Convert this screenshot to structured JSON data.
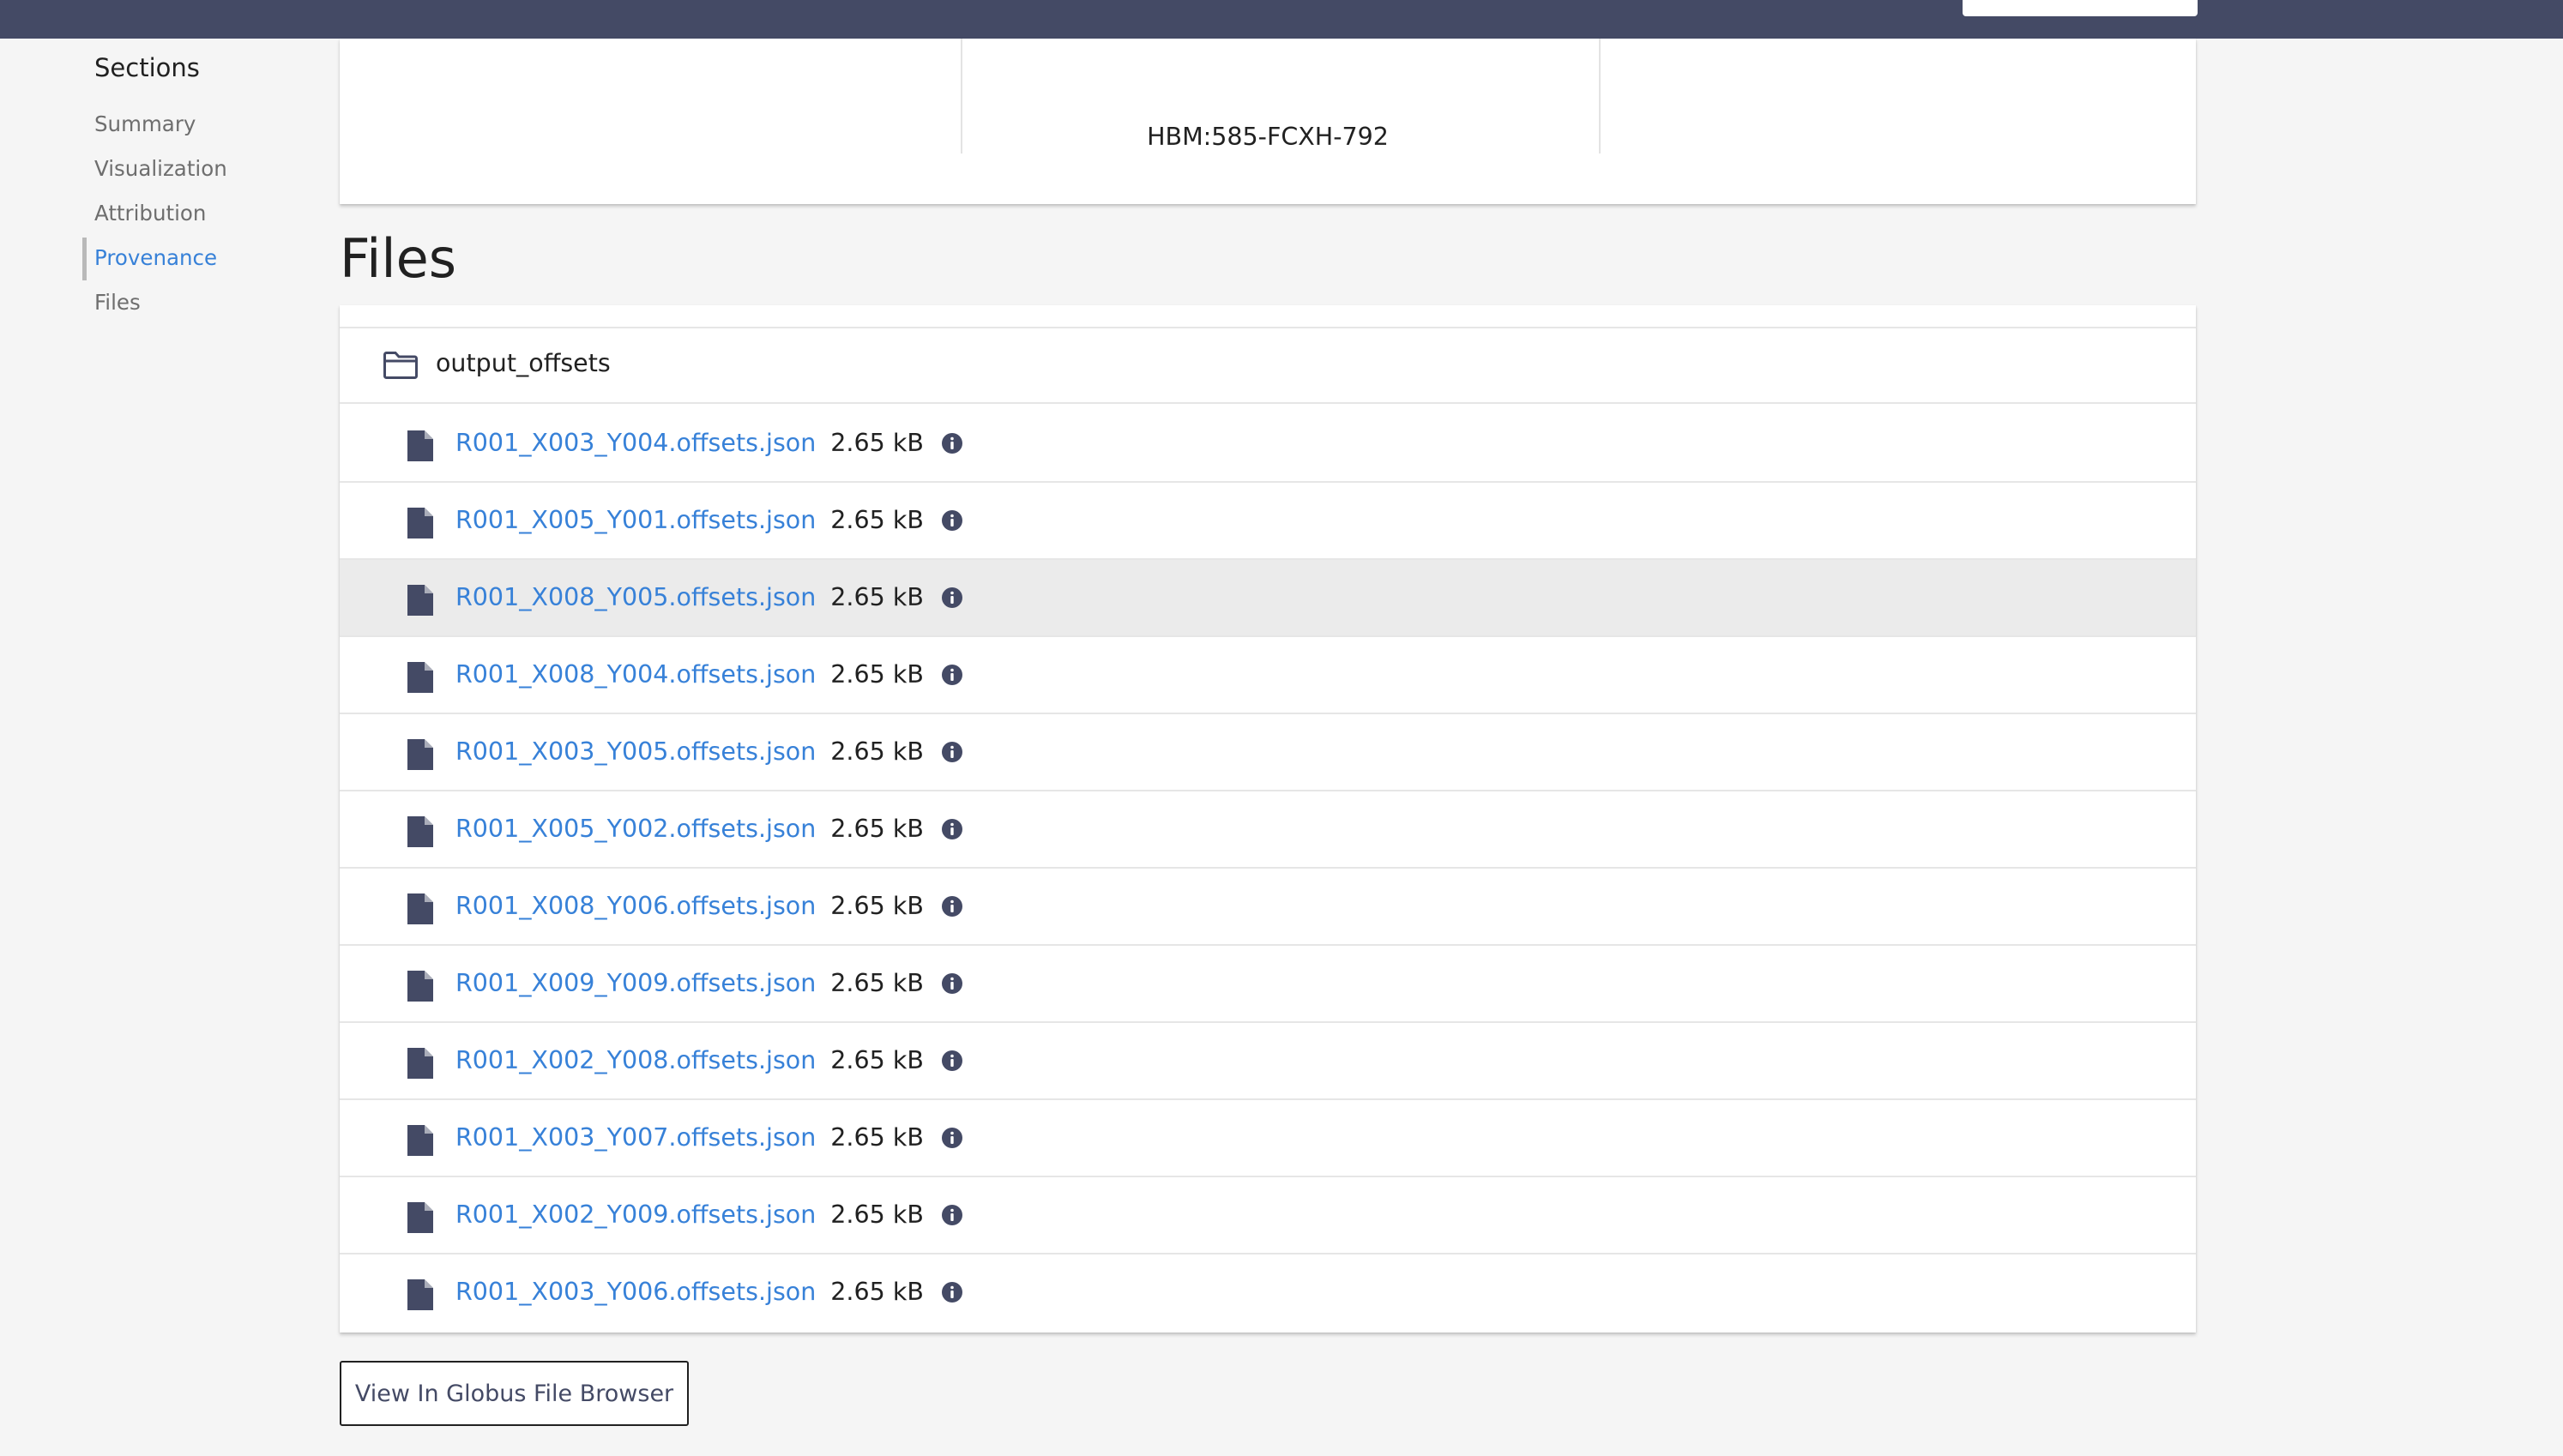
{
  "sidebar": {
    "title": "Sections",
    "items": [
      {
        "label": "Summary",
        "active": false
      },
      {
        "label": "Visualization",
        "active": false
      },
      {
        "label": "Attribution",
        "active": false
      },
      {
        "label": "Provenance",
        "active": true
      },
      {
        "label": "Files",
        "active": false
      }
    ]
  },
  "provenance": {
    "visible_value": "HBM:585-FCXH-792"
  },
  "files_section": {
    "heading": "Files",
    "folder": {
      "icon": "folder-icon",
      "name": "output_offsets"
    },
    "files": [
      {
        "name": "R001_X003_Y004.offsets.json",
        "size": "2.65 kB"
      },
      {
        "name": "R001_X005_Y001.offsets.json",
        "size": "2.65 kB"
      },
      {
        "name": "R001_X008_Y005.offsets.json",
        "size": "2.65 kB",
        "hovered": true
      },
      {
        "name": "R001_X008_Y004.offsets.json",
        "size": "2.65 kB"
      },
      {
        "name": "R001_X003_Y005.offsets.json",
        "size": "2.65 kB"
      },
      {
        "name": "R001_X005_Y002.offsets.json",
        "size": "2.65 kB"
      },
      {
        "name": "R001_X008_Y006.offsets.json",
        "size": "2.65 kB"
      },
      {
        "name": "R001_X009_Y009.offsets.json",
        "size": "2.65 kB"
      },
      {
        "name": "R001_X002_Y008.offsets.json",
        "size": "2.65 kB"
      },
      {
        "name": "R001_X003_Y007.offsets.json",
        "size": "2.65 kB"
      },
      {
        "name": "R001_X002_Y009.offsets.json",
        "size": "2.65 kB"
      },
      {
        "name": "R001_X003_Y006.offsets.json",
        "size": "2.65 kB"
      }
    ],
    "file_icon": "file-icon",
    "info_icon": "info-icon",
    "globus_button_label": "View In Globus File Browser"
  },
  "colors": {
    "topbar": "#444a65",
    "link": "#3781d8",
    "text": "#212121",
    "muted": "#6e6e6e",
    "icon": "#444a65",
    "row_hover": "#ebebeb"
  }
}
